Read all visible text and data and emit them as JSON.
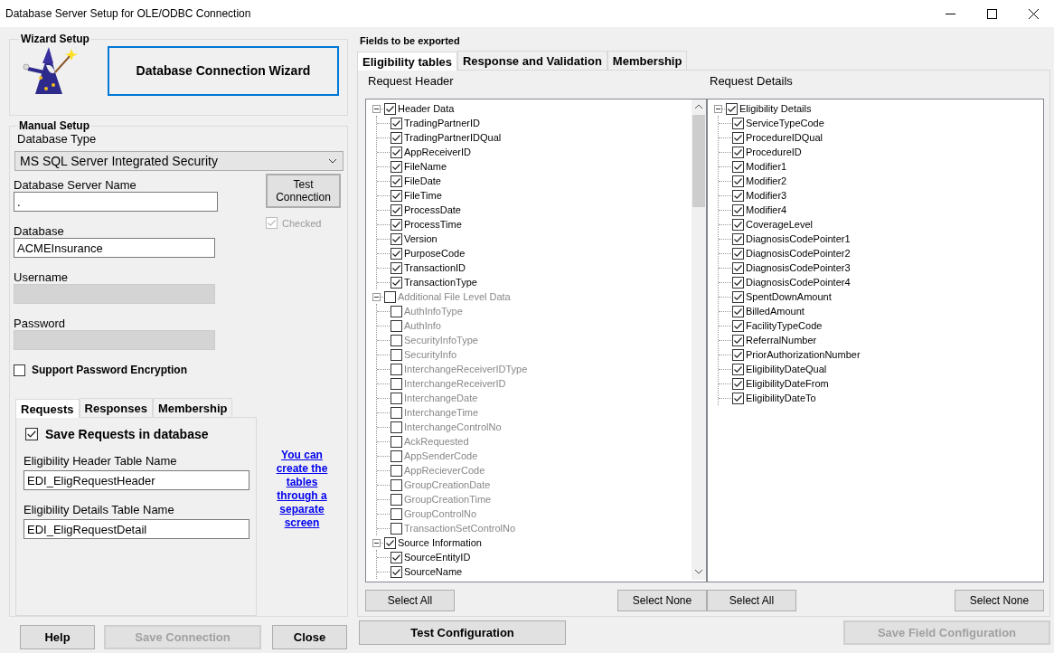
{
  "window": {
    "title": "Database Server Setup for OLE/ODBC Connection"
  },
  "wizard_setup": {
    "title": "Wizard Setup",
    "button": "Database Connection Wizard"
  },
  "manual_setup": {
    "title": "Manual Setup",
    "database_type": {
      "label": "Database Type",
      "value": "MS SQL Server Integrated Security"
    },
    "server_name": {
      "label": "Database Server Name",
      "value": "."
    },
    "test_connection": {
      "label": "Test Connection"
    },
    "connection_checked": {
      "label": "Checked",
      "checked": true,
      "disabled": true
    },
    "database": {
      "label": "Database",
      "value": "ACMEInsurance"
    },
    "username": {
      "label": "Username",
      "disabled": true
    },
    "password": {
      "label": "Password",
      "disabled": true
    },
    "support_encryption": {
      "label": "Support Password Encryption",
      "checked": false
    },
    "tabs": [
      {
        "label": "Requests",
        "selected": true
      },
      {
        "label": "Responses",
        "selected": false
      },
      {
        "label": "Membership",
        "selected": false
      }
    ],
    "save_requests": {
      "label": "Save Requests in database",
      "checked": true
    },
    "header_table": {
      "label": "Eligibility Header Table Name",
      "value": "EDI_EligRequestHeader"
    },
    "details_table": {
      "label": "Eligibility Details Table Name",
      "value": "EDI_EligRequestDetail"
    },
    "link": "You can create the tables through a separate screen"
  },
  "left_buttons": [
    {
      "label": "Help",
      "disabled": false
    },
    {
      "label": "Save Connection",
      "disabled": true
    },
    {
      "label": "Close",
      "disabled": false
    }
  ],
  "fields_to_export": {
    "title": "Fields to be exported",
    "tabs": [
      {
        "label": "Eligibility tables",
        "selected": true
      },
      {
        "label": "Response and Validation",
        "selected": false
      },
      {
        "label": "Membership",
        "selected": false
      }
    ],
    "trees": [
      {
        "label": "Request Header",
        "scrollbar": true,
        "select_all": "Select All",
        "select_none": "Select None",
        "items": [
          {
            "label": "Header Data",
            "checked": true,
            "expanded": true,
            "children": [
              {
                "label": "TradingPartnerID",
                "checked": true
              },
              {
                "label": "TradingPartnerIDQual",
                "checked": true
              },
              {
                "label": "AppReceiverID",
                "checked": true
              },
              {
                "label": "FileName",
                "checked": true
              },
              {
                "label": "FileDate",
                "checked": true
              },
              {
                "label": "FileTime",
                "checked": true
              },
              {
                "label": "ProcessDate",
                "checked": true
              },
              {
                "label": "ProcessTime",
                "checked": true
              },
              {
                "label": "Version",
                "checked": true
              },
              {
                "label": "PurposeCode",
                "checked": true
              },
              {
                "label": "TransactionID",
                "checked": true
              },
              {
                "label": "TransactionType",
                "checked": true
              }
            ]
          },
          {
            "label": "Additional File Level Data",
            "checked": false,
            "expanded": true,
            "children": [
              {
                "label": "AuthInfoType",
                "checked": false
              },
              {
                "label": "AuthInfo",
                "checked": false
              },
              {
                "label": "SecurityInfoType",
                "checked": false
              },
              {
                "label": "SecurityInfo",
                "checked": false
              },
              {
                "label": "InterchangeReceiverIDType",
                "checked": false
              },
              {
                "label": "InterchangeReceiverID",
                "checked": false
              },
              {
                "label": "InterchangeDate",
                "checked": false
              },
              {
                "label": "InterchangeTime",
                "checked": false
              },
              {
                "label": "InterchangeControlNo",
                "checked": false
              },
              {
                "label": "AckRequested",
                "checked": false
              },
              {
                "label": "AppSenderCode",
                "checked": false
              },
              {
                "label": "AppRecieverCode",
                "checked": false
              },
              {
                "label": "GroupCreationDate",
                "checked": false
              },
              {
                "label": "GroupCreationTime",
                "checked": false
              },
              {
                "label": "GroupControlNo",
                "checked": false
              },
              {
                "label": "TransactionSetControlNo",
                "checked": false
              }
            ]
          },
          {
            "label": "Source Information",
            "checked": true,
            "expanded": true,
            "children": [
              {
                "label": "SourceEntityID",
                "checked": true
              },
              {
                "label": "SourceName",
                "checked": true
              }
            ]
          }
        ]
      },
      {
        "label": "Request Details",
        "scrollbar": false,
        "select_all": "Select All",
        "select_none": "Select None",
        "items": [
          {
            "label": "Eligibility Details",
            "checked": true,
            "expanded": true,
            "children": [
              {
                "label": "ServiceTypeCode",
                "checked": true
              },
              {
                "label": "ProcedureIDQual",
                "checked": true
              },
              {
                "label": "ProcedureID",
                "checked": true
              },
              {
                "label": "Modifier1",
                "checked": true
              },
              {
                "label": "Modifier2",
                "checked": true
              },
              {
                "label": "Modifier3",
                "checked": true
              },
              {
                "label": "Modifier4",
                "checked": true
              },
              {
                "label": "CoverageLevel",
                "checked": true
              },
              {
                "label": "DiagnosisCodePointer1",
                "checked": true
              },
              {
                "label": "DiagnosisCodePointer2",
                "checked": true
              },
              {
                "label": "DiagnosisCodePointer3",
                "checked": true
              },
              {
                "label": "DiagnosisCodePointer4",
                "checked": true
              },
              {
                "label": "SpentDownAmount",
                "checked": true
              },
              {
                "label": "BilledAmount",
                "checked": true
              },
              {
                "label": "FacilityTypeCode",
                "checked": true
              },
              {
                "label": "ReferralNumber",
                "checked": true
              },
              {
                "label": "PriorAuthorizationNumber",
                "checked": true
              },
              {
                "label": "EligibilityDateQual",
                "checked": true
              },
              {
                "label": "EligibilityDateFrom",
                "checked": true
              },
              {
                "label": "EligibilityDateTo",
                "checked": true
              }
            ]
          }
        ]
      }
    ]
  },
  "bottom_buttons": [
    {
      "label": "Test Configuration",
      "disabled": false
    },
    {
      "label": "Save Field Configuration",
      "disabled": true
    }
  ]
}
